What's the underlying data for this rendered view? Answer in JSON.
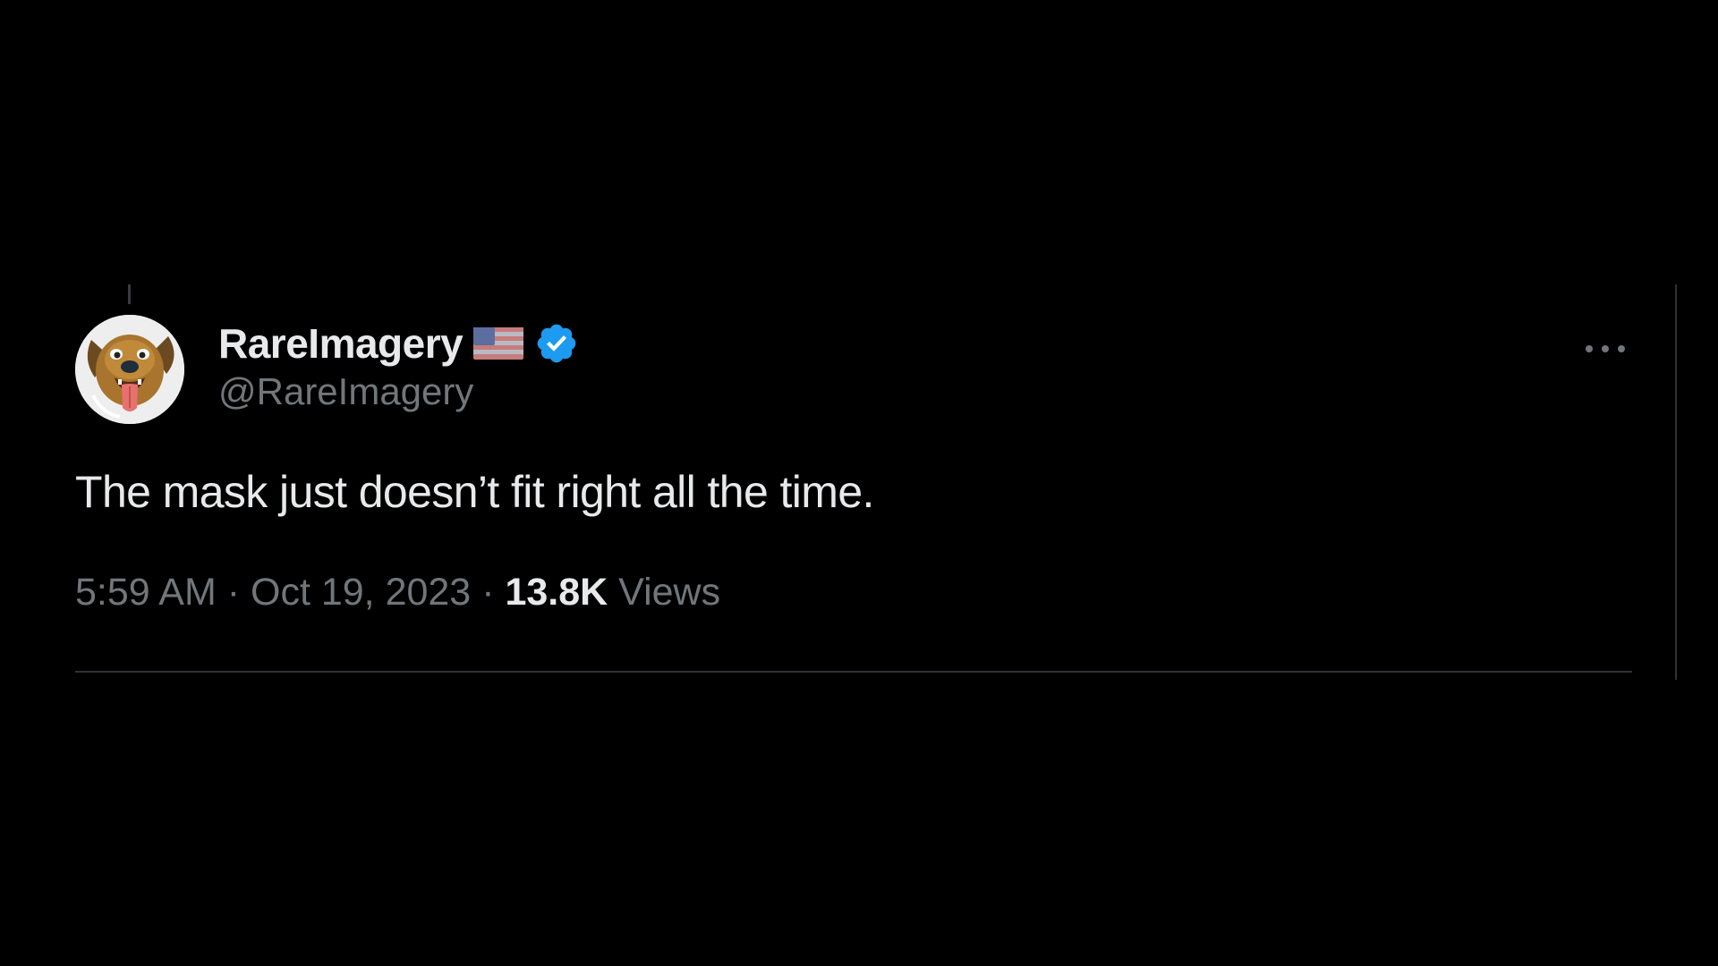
{
  "tweet": {
    "author": {
      "display_name": "RareImagery",
      "handle": "@RareImagery",
      "avatar_icon": "dog-avatar",
      "flag_icon": "us-flag-icon",
      "verified_icon": "verified-badge-icon",
      "verified_color": "#1d9bf0"
    },
    "more_icon": "more-dots-icon",
    "text": "The mask just doesn’t fit right all the time.",
    "time": "5:59 AM",
    "separator": "·",
    "date": "Oct 19, 2023",
    "views_count": "13.8K",
    "views_label": "Views"
  },
  "colors": {
    "background": "#000000",
    "primary_text": "#e7e9ea",
    "secondary_text": "#71767b",
    "border": "#2f3336",
    "accent": "#1d9bf0"
  }
}
